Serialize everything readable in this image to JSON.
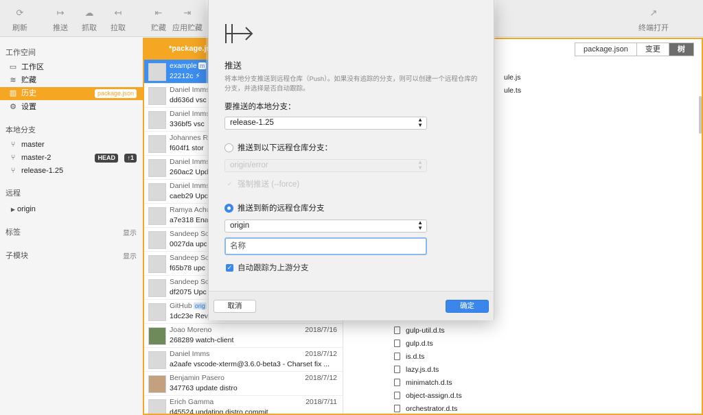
{
  "toolbar": {
    "left": [
      {
        "icon": "refresh-icon",
        "glyph": "⟳",
        "label": "刷新"
      },
      {
        "icon": "push-icon",
        "glyph": "↦",
        "label": "推送"
      },
      {
        "icon": "fetch-icon",
        "glyph": "☁",
        "label": "抓取"
      },
      {
        "icon": "pull-icon",
        "glyph": "↤",
        "label": "拉取"
      },
      {
        "icon": "stash-icon",
        "glyph": "⇤",
        "label": "贮藏"
      },
      {
        "icon": "apply-stash-icon",
        "glyph": "⇥",
        "label": "应用贮藏"
      }
    ],
    "right": {
      "icon": "terminal-icon",
      "glyph": "↗",
      "label": "终端打开"
    }
  },
  "sidebar": {
    "workspace_title": "工作空间",
    "workspace_items": [
      {
        "icon": "folder-icon",
        "glyph": "▭",
        "label": "工作区"
      },
      {
        "icon": "stash-stack-icon",
        "glyph": "≋",
        "label": "贮藏"
      },
      {
        "icon": "history-icon",
        "glyph": "▥",
        "label": "历史",
        "badge": "package.json",
        "active": true
      },
      {
        "icon": "gear-icon",
        "glyph": "⚙",
        "label": "设置"
      }
    ],
    "local_title": "本地分支",
    "branches": [
      {
        "label": "master"
      },
      {
        "label": "master-2",
        "head": "HEAD",
        "ahead": "↑1"
      },
      {
        "label": "release-1.25"
      }
    ],
    "remote_title": "远程",
    "remotes": [
      {
        "label": "origin"
      }
    ],
    "tags_title": "标签",
    "tags_show": "显示",
    "submodules_title": "子模块",
    "submodules_show": "显示"
  },
  "main": {
    "tab_title": "*package.js",
    "view_buttons": [
      "package.json",
      "变更",
      "树"
    ],
    "active_view": "树",
    "commits": [
      {
        "author": "example",
        "tag": "m",
        "hash_msg": "22212c ⚡ ",
        "date": "",
        "selected": true
      },
      {
        "author": "Daniel Imms",
        "hash_msg": "dd636d vsc",
        "date": ""
      },
      {
        "author": "Daniel Imms",
        "hash_msg": "336bf5 vsc",
        "date": ""
      },
      {
        "author": "Johannes R",
        "hash_msg": "f604f1 stor",
        "date": ""
      },
      {
        "author": "Daniel Imms",
        "hash_msg": "260ac2 Upd",
        "date": ""
      },
      {
        "author": "Daniel Imms",
        "hash_msg": "caeb29 Upc",
        "date": ""
      },
      {
        "author": "Ramya Achu",
        "hash_msg": "a7e318 Ena",
        "date": ""
      },
      {
        "author": "Sandeep Sc",
        "hash_msg": "0027da upc",
        "date": ""
      },
      {
        "author": "Sandeep Sc",
        "hash_msg": "f65b78 upc",
        "date": ""
      },
      {
        "author": "Sandeep Sc",
        "hash_msg": "df2075 Upc",
        "date": ""
      },
      {
        "author": "GitHub",
        "tag": "orig",
        "hash_msg": "1dc23e Rev",
        "date": ""
      },
      {
        "author": "Joao Moreno",
        "hash_msg": "268289 watch-client",
        "date": "2018/7/16",
        "photo": true
      },
      {
        "author": "Daniel Imms",
        "hash_msg": "a2aafe vscode-xterm@3.6.0-beta3 - Charset fix ...",
        "date": "2018/7/12"
      },
      {
        "author": "Benjamin Pasero",
        "hash_msg": "347763 update distro",
        "date": "2018/7/12",
        "photo": true
      },
      {
        "author": "Erich Gamma",
        "hash_msg": "d45524 updating distro commit",
        "date": "2018/7/11"
      }
    ],
    "files_top": [
      "ule.js",
      "ule.ts"
    ],
    "files": [
      "gulp-util.d.ts",
      "gulp.d.ts",
      "is.d.ts",
      "lazy.js.d.ts",
      "minimatch.d.ts",
      "object-assign.d.ts",
      "orchestrator.d.ts"
    ]
  },
  "dialog": {
    "title": "推送",
    "description": "将本地分支推送到远程仓库（Push）。如果没有追踪的分支，则可以创建一个远程仓库的分支，并选择是否自动跟踪。",
    "local_branch_label": "要推送的本地分支：",
    "local_branch_value": "release-1.25",
    "remote_existing_label": "推送到以下远程仓库分支：",
    "remote_existing_value": "origin/error",
    "force_label": "强制推送 (--force)",
    "remote_new_label": "推送到新的远程仓库分支",
    "remote_value": "origin",
    "name_placeholder": "名称",
    "track_label": "自动跟踪为上游分支",
    "cancel_label": "取消",
    "ok_label": "确定"
  },
  "colors": {
    "accent": "#f5a623",
    "selection": "#3c8ef0",
    "primary_button": "#3a86ea"
  }
}
